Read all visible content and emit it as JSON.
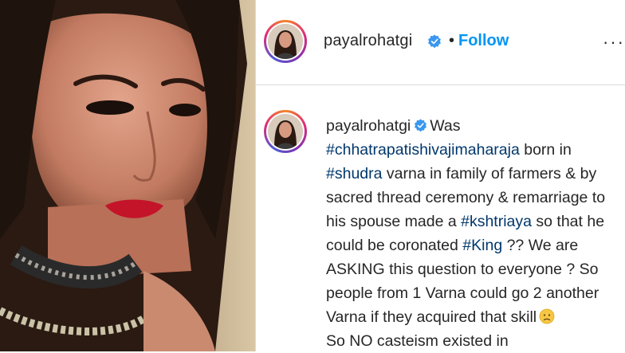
{
  "post": {
    "username": "payalrohatgi",
    "separator": "•",
    "follow_label": "Follow",
    "more_label": "···"
  },
  "caption": {
    "username": "payalrohatgi",
    "t1": "Was",
    "h1": "#chhatrapatishivajimaharaja",
    "t2": " born in",
    "h2": "#shudra",
    "t3": " varna in family of farmers & by sacred thread ceremony & remarriage to his spouse made a ",
    "h3": "#kshtriaya",
    "t4": " so that he could be coronated ",
    "h4": "#King",
    "t5": " ?? We are ASKING this question to everyone ? So people from 1 Varna could go 2 another Varna if they acquired that skill",
    "emoji": "worried-face-emoji",
    "t6": "So NO casteism existed in"
  },
  "colors": {
    "link": "#00376b",
    "follow": "#0095f6",
    "verified": "#3897f0"
  }
}
